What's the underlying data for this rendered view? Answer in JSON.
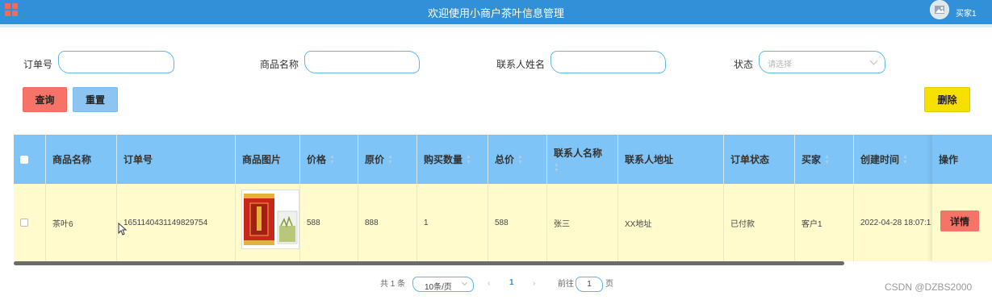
{
  "header": {
    "title": "欢迎使用小商户茶叶信息管理",
    "user_name": "买家1"
  },
  "filters": {
    "order_no_label": "订单号",
    "order_no_value": "",
    "product_name_label": "商品名称",
    "product_name_value": "",
    "contact_name_label": "联系人姓名",
    "contact_name_value": "",
    "status_label": "状态",
    "status_placeholder": "请选择"
  },
  "actions": {
    "query": "查询",
    "reset": "重置",
    "delete": "删除"
  },
  "table": {
    "columns": [
      "商品名称",
      "订单号",
      "商品图片",
      "价格",
      "原价",
      "购买数量",
      "总价",
      "联系人名称",
      "联系人地址",
      "订单状态",
      "买家",
      "创建时间",
      "操作"
    ],
    "rows": [
      {
        "product_name": "茶叶6",
        "order_no": "1651140431149829754",
        "price": "588",
        "original_price": "888",
        "quantity": "1",
        "total": "588",
        "contact_name": "张三",
        "contact_address": "XX地址",
        "order_status": "已付款",
        "buyer": "客户1",
        "created_at": "2022-04-28 18:07:1",
        "detail_label": "详情"
      }
    ]
  },
  "pagination": {
    "total": "共 1 条",
    "page_size": "10条/页",
    "prev": "‹",
    "current_page": "1",
    "next": "›",
    "goto_label": "前往",
    "goto_value": "1",
    "page_unit": "页"
  },
  "watermark": "CSDN @DZBS2000",
  "colors": {
    "header": "#3290d8",
    "table_header": "#7fc4f6",
    "row_bg": "#fffbcd",
    "query_button": "#f67467",
    "reset_button": "#8cc4f2",
    "delete_button": "#f7df00"
  }
}
